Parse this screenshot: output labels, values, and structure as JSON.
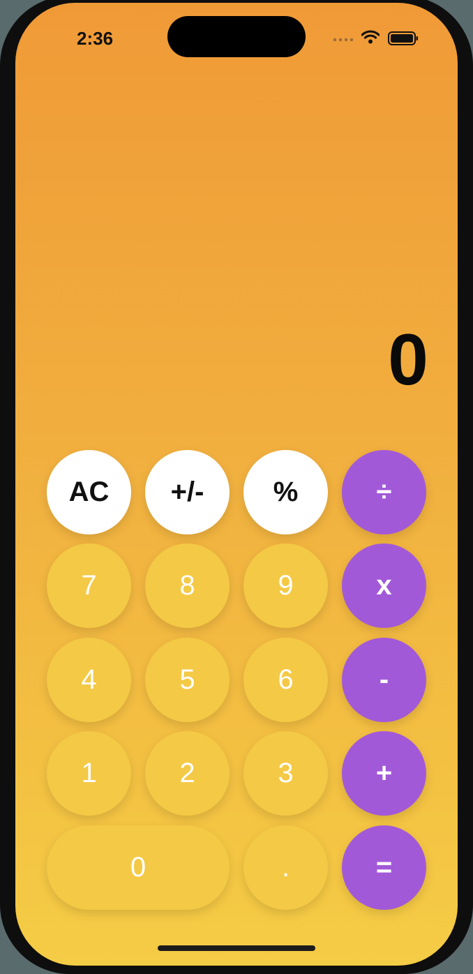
{
  "status_bar": {
    "time": "2:36",
    "icons": [
      "cellular-signal-icon",
      "wifi-icon",
      "battery-icon"
    ]
  },
  "display": {
    "value": "0"
  },
  "keys": {
    "ac": "AC",
    "sign": "+/-",
    "percent": "%",
    "divide": "÷",
    "seven": "7",
    "eight": "8",
    "nine": "9",
    "multiply": "x",
    "four": "4",
    "five": "5",
    "six": "6",
    "subtract": "-",
    "one": "1",
    "two": "2",
    "three": "3",
    "add": "+",
    "zero": "0",
    "decimal": ".",
    "equals": "="
  },
  "colors": {
    "gradient_top": "#f09a37",
    "gradient_bottom": "#f5cc45",
    "function_key": "#ffffff",
    "number_key": "#f4c945",
    "operator_key": "#a259d8"
  }
}
